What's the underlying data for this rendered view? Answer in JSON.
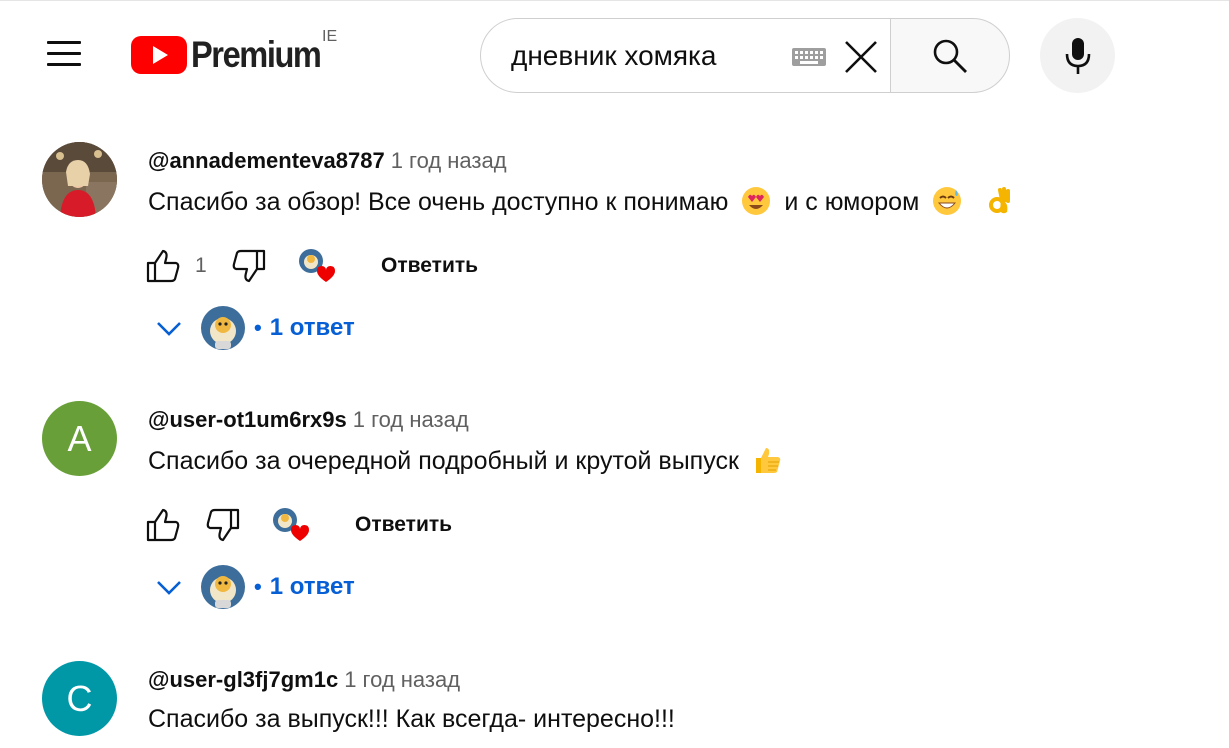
{
  "header": {
    "logo_text": "Premium",
    "region": "IE",
    "search_value": "дневник хомяка",
    "colors": {
      "brand_red": "#ff0000",
      "link_blue": "#065fd4"
    }
  },
  "comments": [
    {
      "author": "@annadementeva8787",
      "time": "1 год назад",
      "text": "Спасибо за обзор! Все очень доступно к понимаю",
      "text_mid": "и с юмором",
      "emojis": [
        "heart-eyes-emoji",
        "sweat-smile-emoji",
        "ok-hand-emoji"
      ],
      "likes": "1",
      "reply_label": "Ответить",
      "replies_label": "1 ответ",
      "avatar_type": "photo"
    },
    {
      "author": "@user-ot1um6rx9s",
      "time": "1 год назад",
      "text": "Спасибо за очередной подробный и крутой выпуск",
      "emojis": [
        "thumbs-up-emoji"
      ],
      "likes": "",
      "reply_label": "Ответить",
      "replies_label": "1 ответ",
      "avatar_letter": "A",
      "avatar_color": "#689f38"
    },
    {
      "author": "@user-gl3fj7gm1c",
      "time": "1 год назад",
      "text": "Спасибо за выпуск!!! Как всегда- интересно!!!",
      "avatar_letter": "C",
      "avatar_color": "#0097a7"
    }
  ]
}
